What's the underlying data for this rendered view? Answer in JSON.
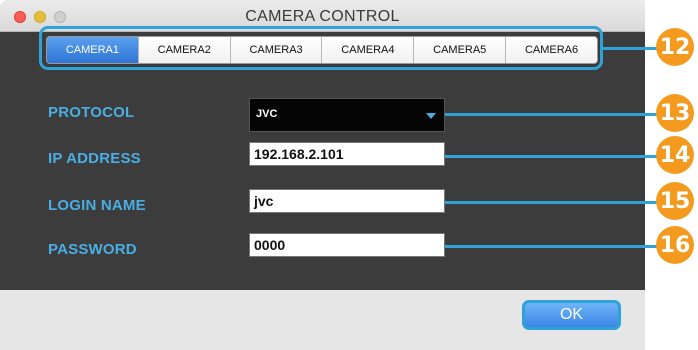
{
  "window": {
    "title": "CAMERA CONTROL"
  },
  "tabs": [
    "CAMERA1",
    "CAMERA2",
    "CAMERA3",
    "CAMERA4",
    "CAMERA5",
    "CAMERA6"
  ],
  "form": {
    "protocol": {
      "label": "PROTOCOL",
      "value": "JVC"
    },
    "ip_address": {
      "label": "IP ADDRESS",
      "value": "192.168.2.101"
    },
    "login_name": {
      "label": "LOGIN NAME",
      "value": "jvc"
    },
    "password": {
      "label": "PASSWORD",
      "value": "0000"
    }
  },
  "buttons": {
    "ok": "OK"
  },
  "callouts": [
    "12",
    "13",
    "14",
    "15",
    "16"
  ],
  "colors": {
    "accent": "#2fa3d8",
    "label": "#4aaee5",
    "callout": "#f39a1f",
    "active_tab": "#2d74d6"
  }
}
